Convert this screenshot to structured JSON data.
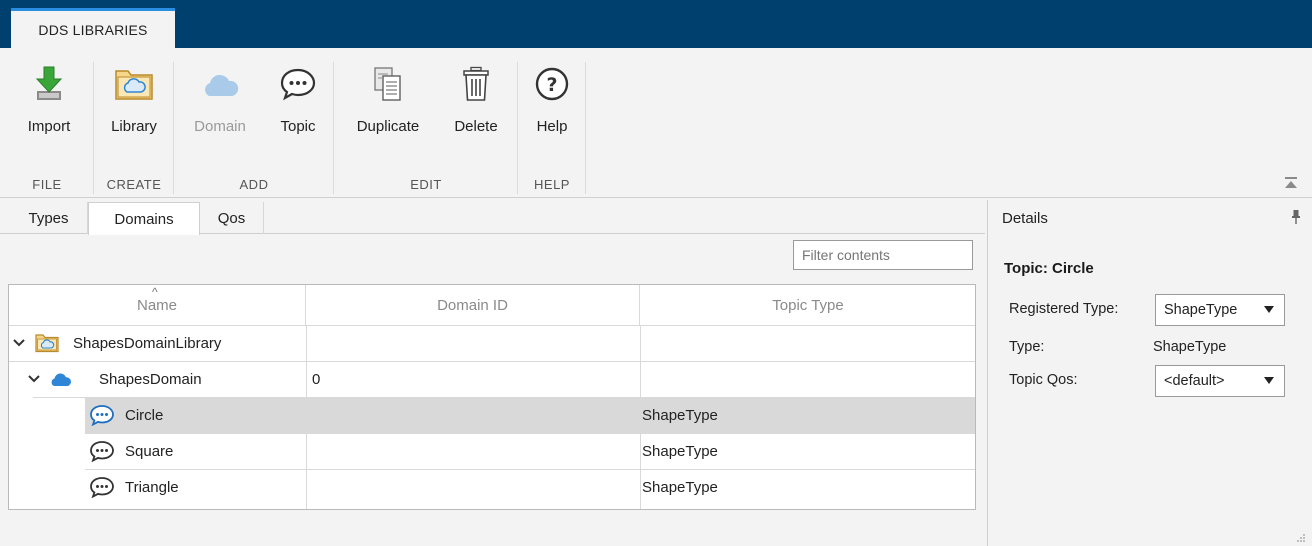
{
  "ribbon_tab": {
    "label": "DDS LIBRARIES"
  },
  "ribbon": {
    "file": {
      "label": "FILE",
      "import_label": "Import"
    },
    "create": {
      "label": "CREATE",
      "library_label": "Library"
    },
    "add": {
      "label": "ADD",
      "domain_label": "Domain",
      "topic_label": "Topic"
    },
    "edit": {
      "label": "EDIT",
      "duplicate_label": "Duplicate",
      "delete_label": "Delete"
    },
    "help": {
      "label": "HELP",
      "help_label": "Help"
    }
  },
  "doc_tabs": [
    "Types",
    "Domains",
    "Qos"
  ],
  "active_tab": "Domains",
  "filter": {
    "placeholder": "Filter contents"
  },
  "table": {
    "columns": [
      "Name",
      "Domain ID",
      "Topic Type"
    ],
    "rows": [
      {
        "name": "ShapesDomainLibrary",
        "domain_id": "",
        "topic_type": ""
      },
      {
        "name": "ShapesDomain",
        "domain_id": "0",
        "topic_type": ""
      },
      {
        "name": "Circle",
        "domain_id": "",
        "topic_type": "ShapeType"
      },
      {
        "name": "Square",
        "domain_id": "",
        "topic_type": "ShapeType"
      },
      {
        "name": "Triangle",
        "domain_id": "",
        "topic_type": "ShapeType"
      }
    ]
  },
  "details": {
    "title": "Details",
    "heading": "Topic: Circle",
    "registered_type_label": "Registered Type:",
    "registered_type_value": "ShapeType",
    "type_label": "Type:",
    "type_value": "ShapeType",
    "topic_qos_label": "Topic Qos:",
    "topic_qos_value": "<default>"
  },
  "colors": {
    "header_bar": "#00406f",
    "tab_accent": "#2b8de0",
    "selected_row": "#d9d9d9",
    "topic_icon_selected": "#1f6fbf",
    "domain_icon": "#2f86d6",
    "library_icon": "#e0a93a"
  }
}
